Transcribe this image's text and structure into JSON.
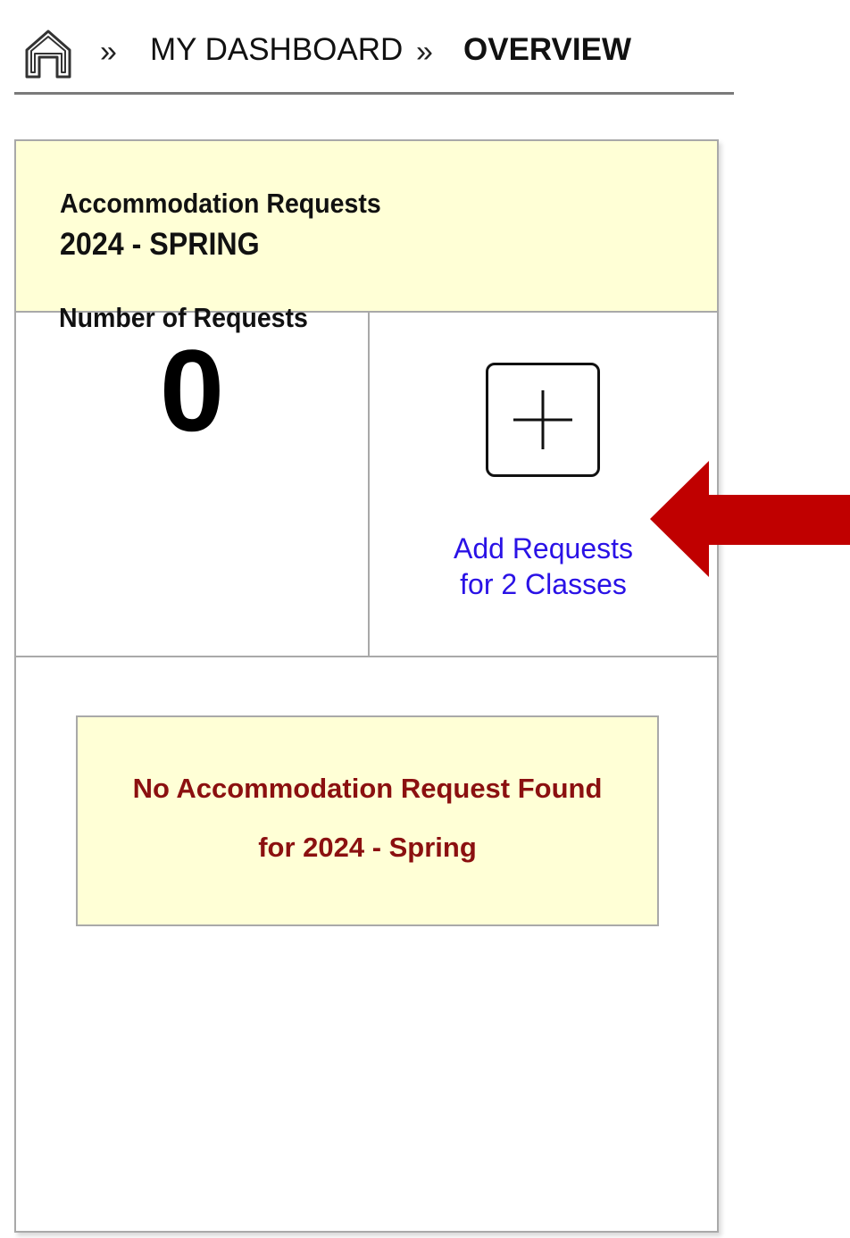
{
  "breadcrumb": {
    "home_icon": "home-icon",
    "separator": "»",
    "items": [
      {
        "label": "MY DASHBOARD"
      },
      {
        "label": "OVERVIEW"
      }
    ]
  },
  "card": {
    "title": "Accommodation Requests",
    "term": "2024 - SPRING",
    "requests_label": "Number of Requests",
    "requests_count": "0",
    "add_icon": "plus-icon",
    "add_link_line1": "Add Requests",
    "add_link_line2": "for 2 Classes",
    "empty_line1": "No Accommodation Request Found",
    "empty_line2": "for 2024 - Spring"
  },
  "annotation": {
    "arrow_icon": "arrow-left-icon",
    "arrow_color": "#c00000"
  },
  "colors": {
    "header_bg": "#ffffd6",
    "link": "#2a12e6",
    "empty_text": "#8b1010"
  }
}
